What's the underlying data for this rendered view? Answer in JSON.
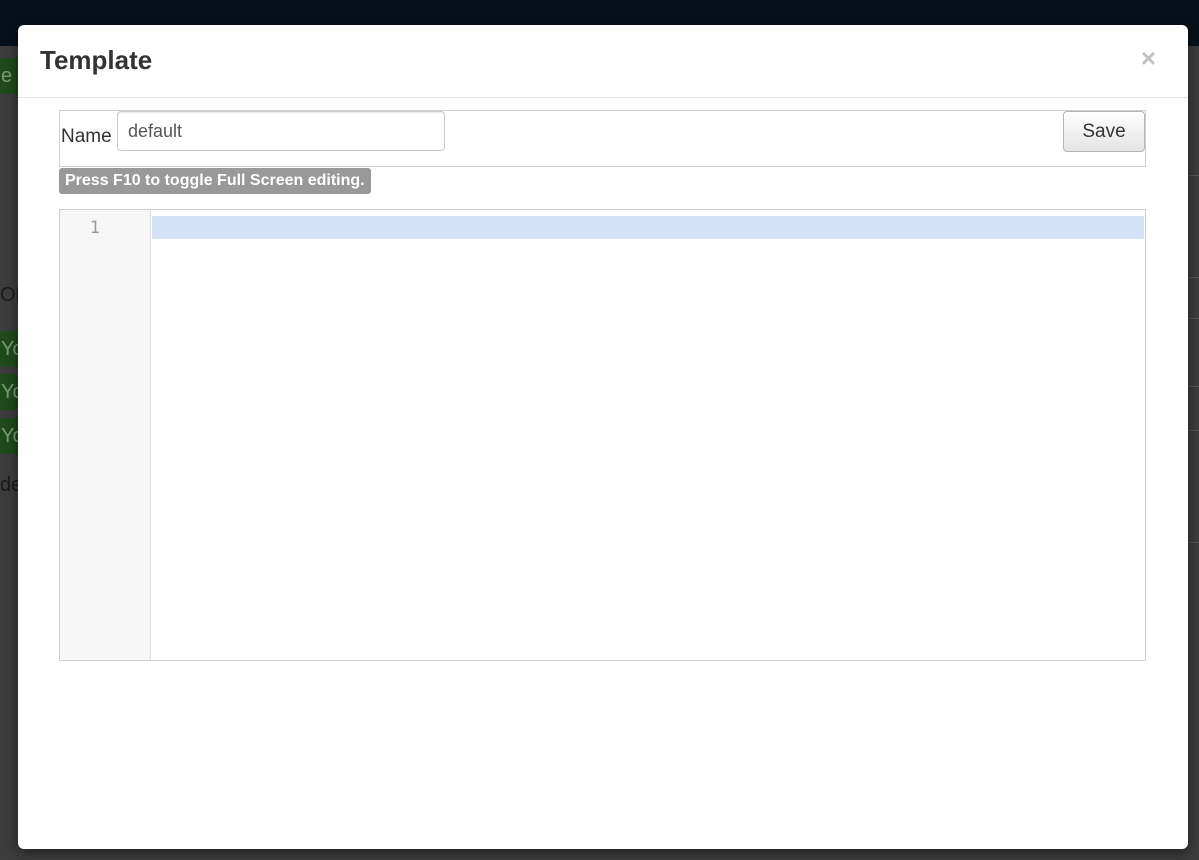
{
  "modal": {
    "title": "Template",
    "close_label": "×",
    "name_label": "Name",
    "name_value": "default",
    "save_label": "Save",
    "hint": "Press F10 to toggle Full Screen editing."
  },
  "editor": {
    "line_numbers": [
      "1"
    ],
    "content": ""
  },
  "background": {
    "partial_text": [
      "e",
      "OR",
      "Yo",
      "Yo",
      "Yo",
      "de"
    ]
  },
  "colors": {
    "topbar": "#07101a",
    "active_line": "#d3e2f6",
    "badge": "#999999"
  }
}
